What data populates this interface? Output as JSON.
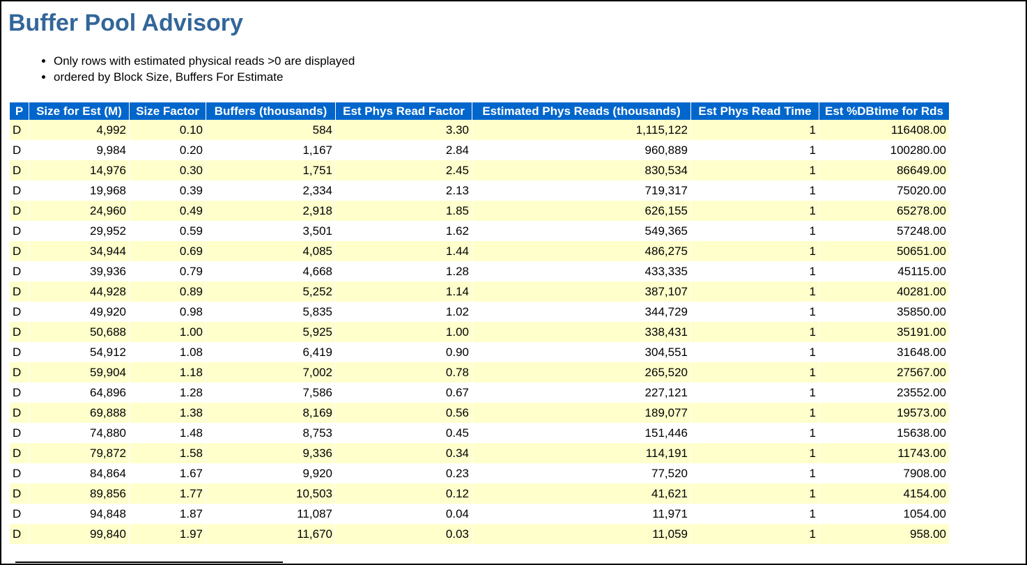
{
  "page": {
    "title": "Buffer Pool Advisory",
    "notes": [
      "Only rows with estimated physical reads >0 are displayed",
      "ordered by Block Size, Buffers For Estimate"
    ]
  },
  "colors": {
    "title": "#336699",
    "header_bg": "#0066cc",
    "header_text": "#ffffff",
    "row_highlight": "#ffffcc",
    "row_plain": "#ffffff"
  },
  "table": {
    "headers": [
      "P",
      "Size for Est (M)",
      "Size Factor",
      "Buffers (thousands)",
      "Est Phys Read Factor",
      "Estimated Phys Reads (thousands)",
      "Est Phys Read Time",
      "Est %DBtime for Rds"
    ],
    "rows": [
      [
        "D",
        "4,992",
        "0.10",
        "584",
        "3.30",
        "1,115,122",
        "1",
        "116408.00"
      ],
      [
        "D",
        "9,984",
        "0.20",
        "1,167",
        "2.84",
        "960,889",
        "1",
        "100280.00"
      ],
      [
        "D",
        "14,976",
        "0.30",
        "1,751",
        "2.45",
        "830,534",
        "1",
        "86649.00"
      ],
      [
        "D",
        "19,968",
        "0.39",
        "2,334",
        "2.13",
        "719,317",
        "1",
        "75020.00"
      ],
      [
        "D",
        "24,960",
        "0.49",
        "2,918",
        "1.85",
        "626,155",
        "1",
        "65278.00"
      ],
      [
        "D",
        "29,952",
        "0.59",
        "3,501",
        "1.62",
        "549,365",
        "1",
        "57248.00"
      ],
      [
        "D",
        "34,944",
        "0.69",
        "4,085",
        "1.44",
        "486,275",
        "1",
        "50651.00"
      ],
      [
        "D",
        "39,936",
        "0.79",
        "4,668",
        "1.28",
        "433,335",
        "1",
        "45115.00"
      ],
      [
        "D",
        "44,928",
        "0.89",
        "5,252",
        "1.14",
        "387,107",
        "1",
        "40281.00"
      ],
      [
        "D",
        "49,920",
        "0.98",
        "5,835",
        "1.02",
        "344,729",
        "1",
        "35850.00"
      ],
      [
        "D",
        "50,688",
        "1.00",
        "5,925",
        "1.00",
        "338,431",
        "1",
        "35191.00"
      ],
      [
        "D",
        "54,912",
        "1.08",
        "6,419",
        "0.90",
        "304,551",
        "1",
        "31648.00"
      ],
      [
        "D",
        "59,904",
        "1.18",
        "7,002",
        "0.78",
        "265,520",
        "1",
        "27567.00"
      ],
      [
        "D",
        "64,896",
        "1.28",
        "7,586",
        "0.67",
        "227,121",
        "1",
        "23552.00"
      ],
      [
        "D",
        "69,888",
        "1.38",
        "8,169",
        "0.56",
        "189,077",
        "1",
        "19573.00"
      ],
      [
        "D",
        "74,880",
        "1.48",
        "8,753",
        "0.45",
        "151,446",
        "1",
        "15638.00"
      ],
      [
        "D",
        "79,872",
        "1.58",
        "9,336",
        "0.34",
        "114,191",
        "1",
        "11743.00"
      ],
      [
        "D",
        "84,864",
        "1.67",
        "9,920",
        "0.23",
        "77,520",
        "1",
        "7908.00"
      ],
      [
        "D",
        "89,856",
        "1.77",
        "10,503",
        "0.12",
        "41,621",
        "1",
        "4154.00"
      ],
      [
        "D",
        "94,848",
        "1.87",
        "11,087",
        "0.04",
        "11,971",
        "1",
        "1054.00"
      ],
      [
        "D",
        "99,840",
        "1.97",
        "11,670",
        "0.03",
        "11,059",
        "1",
        "958.00"
      ]
    ]
  }
}
